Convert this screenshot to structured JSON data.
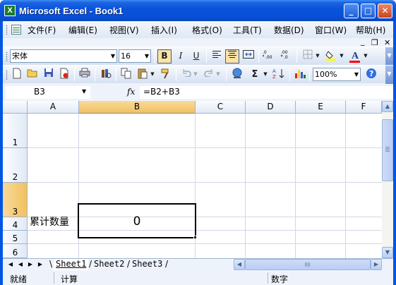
{
  "window": {
    "title": "Microsoft Excel - Book1",
    "app_icon": "X",
    "controls": {
      "minimize": "_",
      "maximize": "□",
      "close": "✕"
    }
  },
  "menu": {
    "items": [
      "文件(F)",
      "编辑(E)",
      "视图(V)",
      "插入(I)",
      "格式(O)",
      "工具(T)",
      "数据(D)",
      "窗口(W)",
      "帮助(H)"
    ],
    "doc_controls": {
      "minimize": "_",
      "restore": "❐",
      "close": "✕"
    }
  },
  "formatting": {
    "font_name": "宋体",
    "font_size": "16",
    "bold": "B",
    "italic": "I",
    "underline": "U",
    "font_color_letter": "A",
    "accent_fill": "#ffff00",
    "accent_font": "#ff0000"
  },
  "standard": {
    "zoom": "100%",
    "sum": "Σ"
  },
  "formula_bar": {
    "name_box": "B3",
    "fx": "fx",
    "formula": "=B2+B3"
  },
  "grid": {
    "columns": [
      "A",
      "B",
      "C",
      "D",
      "E",
      "F"
    ],
    "rows": [
      "1",
      "2",
      "3",
      "4",
      "5",
      "6"
    ],
    "selected_column": "B",
    "selected_row": "3",
    "cells": {
      "A3": "累计数量",
      "B3": "0"
    }
  },
  "sheets": {
    "nav": [
      "◀",
      "◀",
      "▶",
      "▶"
    ],
    "tabs": [
      "Sheet1",
      "Sheet2",
      "Sheet3"
    ],
    "active": "Sheet1"
  },
  "status": {
    "ready": "就绪",
    "calc": "计算",
    "num": "数字"
  },
  "colors": {
    "titlebar": "#0a54dc",
    "selection_header": "#f1c15f"
  }
}
